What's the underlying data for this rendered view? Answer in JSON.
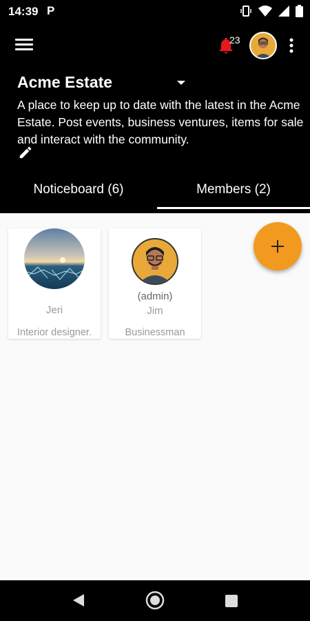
{
  "status_bar": {
    "time": "14:39",
    "notification_icon": "P",
    "icons": [
      "vibrate-icon",
      "wifi-icon",
      "signal-icon",
      "battery-icon"
    ]
  },
  "header": {
    "notification_count": "23",
    "group_name": "Acme Estate",
    "description": "A place to keep up to date with the latest in the Acme Estate. Post events, business ventures, items for sale and interact with the community.",
    "bell_color": "#e5191c"
  },
  "tabs": [
    {
      "label": "Noticeboard (6)",
      "active": false
    },
    {
      "label": "Members (2)",
      "active": true
    }
  ],
  "members": [
    {
      "role": "",
      "name": "Jeri",
      "job": "Interior designer."
    },
    {
      "role": "(admin)",
      "name": "Jim",
      "job": "Businessman"
    }
  ],
  "fab": {
    "icon": "plus-icon",
    "color": "#f29a1f"
  },
  "nav": [
    "back-icon",
    "home-icon",
    "recent-apps-icon"
  ]
}
